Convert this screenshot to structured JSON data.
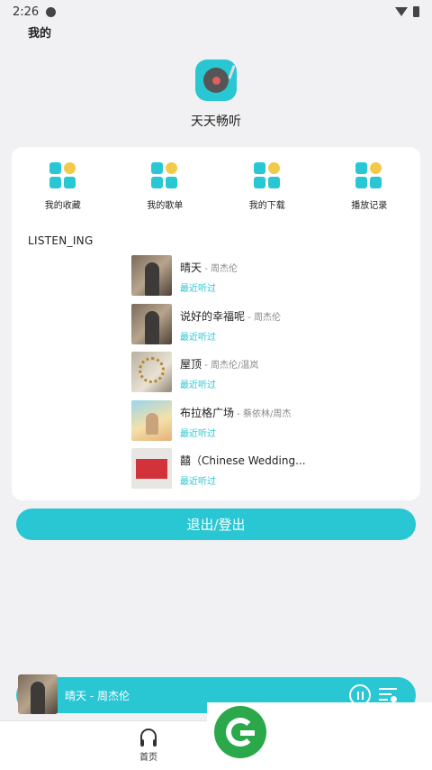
{
  "status_bar": {
    "time": "2:26"
  },
  "page_title": "我的",
  "app": {
    "name": "天天畅听"
  },
  "quick_actions": [
    {
      "label": "我的收藏",
      "icon": "grid-icon"
    },
    {
      "label": "我的歌单",
      "icon": "grid-icon"
    },
    {
      "label": "我的下载",
      "icon": "grid-icon"
    },
    {
      "label": "播放记录",
      "icon": "grid-icon"
    }
  ],
  "listening": {
    "title": "LISTEN_ING",
    "songs": [
      {
        "title": "晴天",
        "artist": " - 周杰伦",
        "tag": "最近听过"
      },
      {
        "title": "说好的幸福呢",
        "artist": " - 周杰伦",
        "tag": "最近听过"
      },
      {
        "title": "屋顶",
        "artist": " - 周杰伦/温岚",
        "tag": "最近听过"
      },
      {
        "title": "布拉格广场",
        "artist": " - 蔡依林/周杰",
        "tag": "最近听过"
      },
      {
        "title": "囍（Chinese Wedding...",
        "artist": "",
        "tag": "最近听过"
      }
    ]
  },
  "logout_label": "退出/登出",
  "mini_player": {
    "now_playing": "晴天 - 周杰伦"
  },
  "bottom_nav": {
    "home_label": "首页"
  },
  "colors": {
    "accent": "#29c7d4",
    "highlight": "#f3c94a"
  }
}
